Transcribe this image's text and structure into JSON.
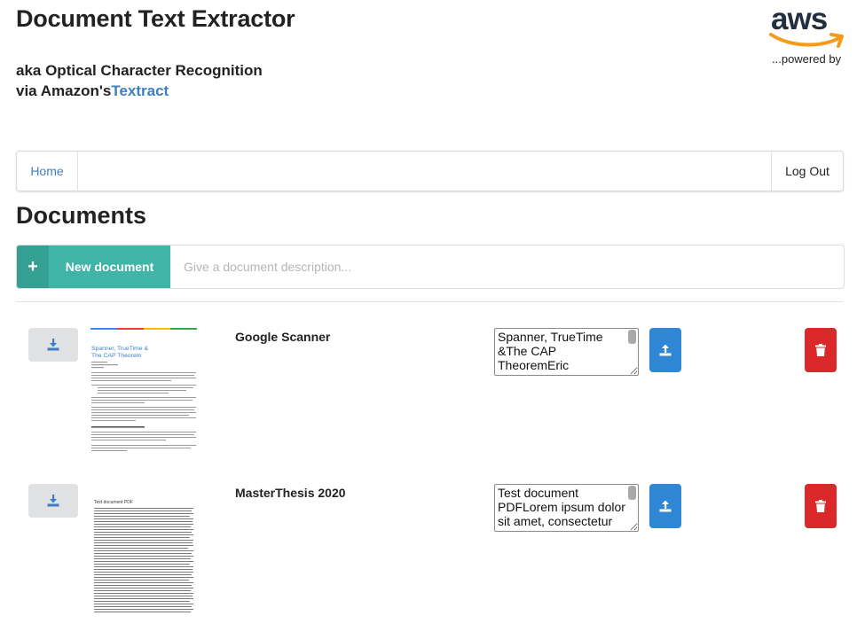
{
  "header": {
    "title": "Document Text Extractor",
    "subtitle_line1": "aka Optical Character Recognition",
    "subtitle_line2_prefix": "via Amazon's",
    "subtitle_link": "Textract",
    "logo_text": "aws",
    "powered_by": "...powered by"
  },
  "nav": {
    "home": "Home",
    "logout": "Log Out"
  },
  "documents": {
    "heading": "Documents",
    "new_button_label": "New document",
    "description_placeholder": "Give a document description...",
    "items": [
      {
        "name": "Google Scanner",
        "extracted_text": "Spanner, TrueTime &The CAP TheoremEric",
        "thumbnail_title": "Spanner, TrueTime & The CAP Theorem"
      },
      {
        "name": "MasterThesis 2020",
        "extracted_text": "Test document PDFLorem ipsum dolor sit amet, consectetur",
        "thumbnail_title": "Test document PDF"
      }
    ]
  },
  "icons": {
    "new": "plus-icon",
    "download": "download-icon",
    "upload": "upload-icon",
    "delete": "trash-icon"
  },
  "colors": {
    "link": "#3d7fc4",
    "teal": "#40b4a6",
    "teal_dark": "#35a194",
    "upload": "#2f86d4",
    "delete": "#db2828",
    "download_bg": "#e0e1e2"
  }
}
